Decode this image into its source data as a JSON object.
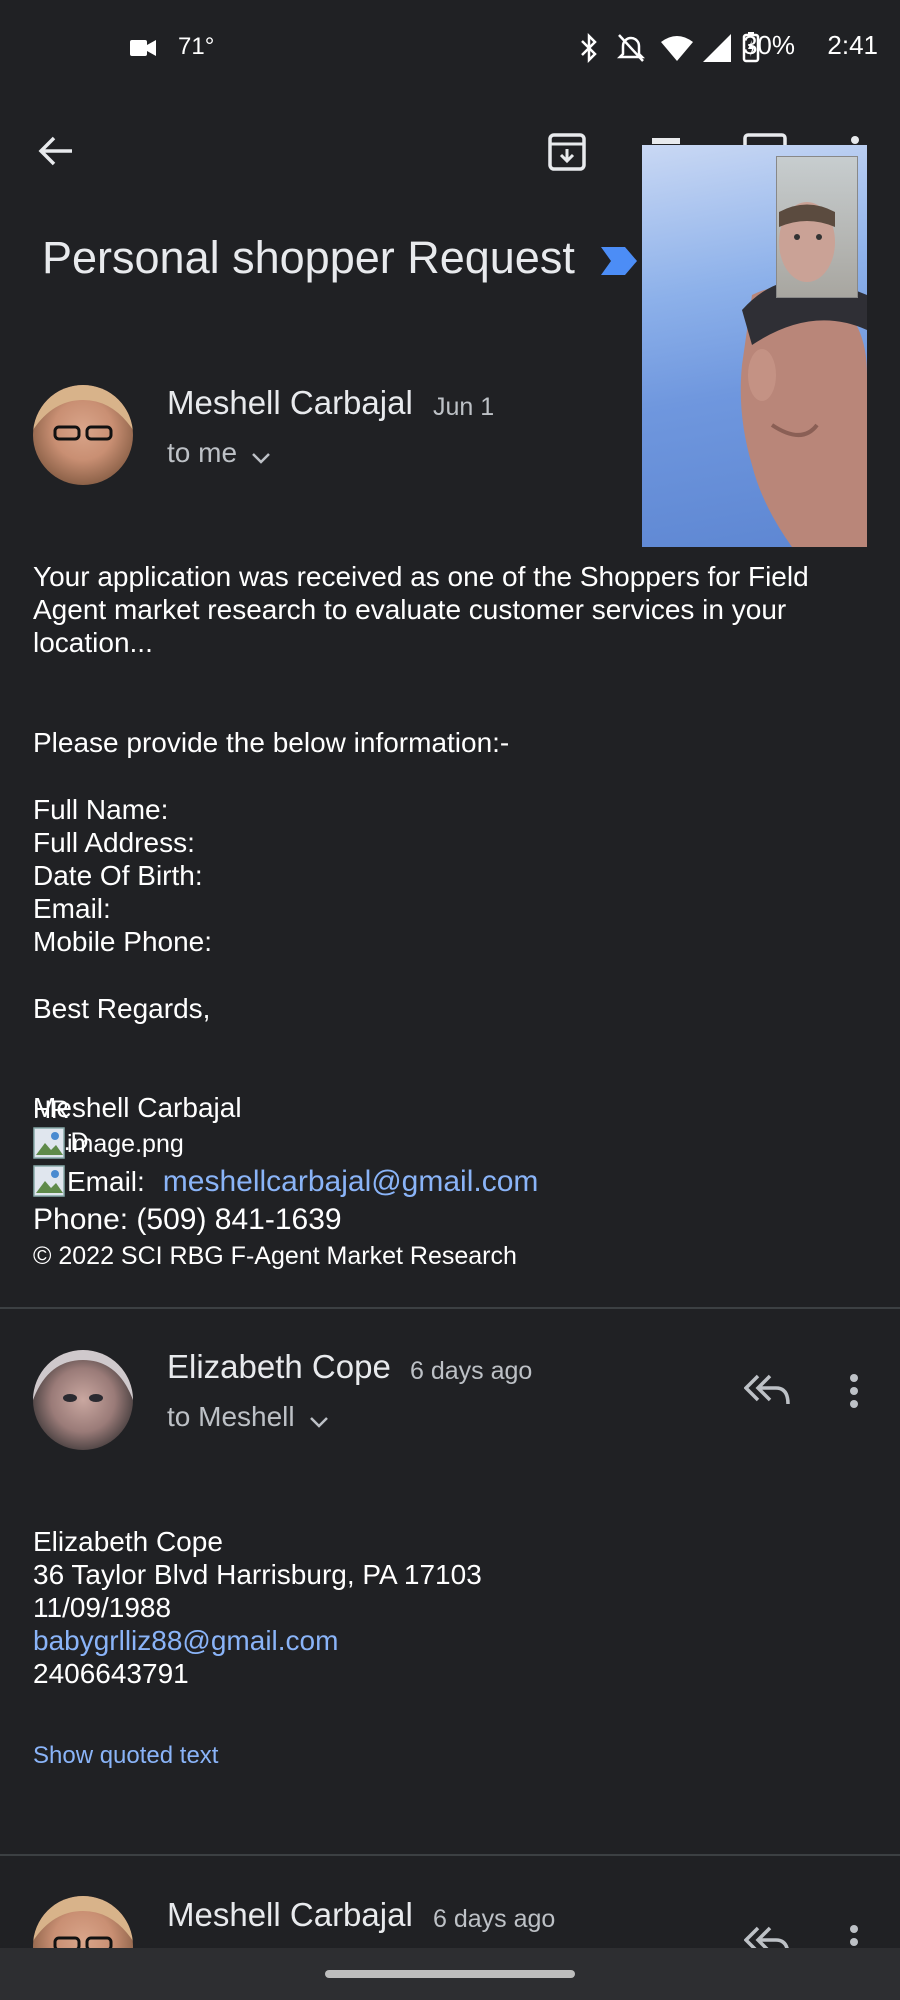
{
  "status_bar": {
    "temperature": "71°",
    "battery": "30%",
    "time": "2:41"
  },
  "toolbar": {
    "back": "arrow-back-icon",
    "archive": "archive-icon",
    "delete": "delete-icon",
    "mail": "mail-icon",
    "more": "more-vert-icon"
  },
  "subject": "Personal shopper Request",
  "messages": [
    {
      "sender": "Meshell Carbajal",
      "date": "Jun 1",
      "to": "to me",
      "body_intro": "Your application was received as one of the Shoppers for Field Agent market research to evaluate customer services in your location...",
      "body_request": "Please provide the below information:-",
      "fields": [
        "Full Name:",
        "Full Address:",
        "Date Of Birth:",
        "Email:",
        "Mobile Phone:"
      ],
      "closing": "Best Regards,",
      "sig_name": "Meshell Carbajal",
      "sig_degree": "Ph.D",
      "sig_title": "HR",
      "sig_image": "image.png",
      "sig_email_label": "Email:",
      "sig_email": "meshellcarbajal@gmail.com",
      "sig_phone": "Phone: (509) 841-1639",
      "sig_copyright": "© 2022 SCI RBG F-Agent Market Research"
    },
    {
      "sender": "Elizabeth Cope",
      "date": "6 days ago",
      "to": "to Meshell",
      "lines": [
        "Elizabeth Cope",
        "36 Taylor Blvd Harrisburg, PA 17103",
        "11/09/1988"
      ],
      "email": "babygrlliz88@gmail.com",
      "phone": "2406643791",
      "show_quoted": "Show quoted text"
    },
    {
      "sender": "Meshell Carbajal",
      "date": "6 days ago"
    }
  ]
}
